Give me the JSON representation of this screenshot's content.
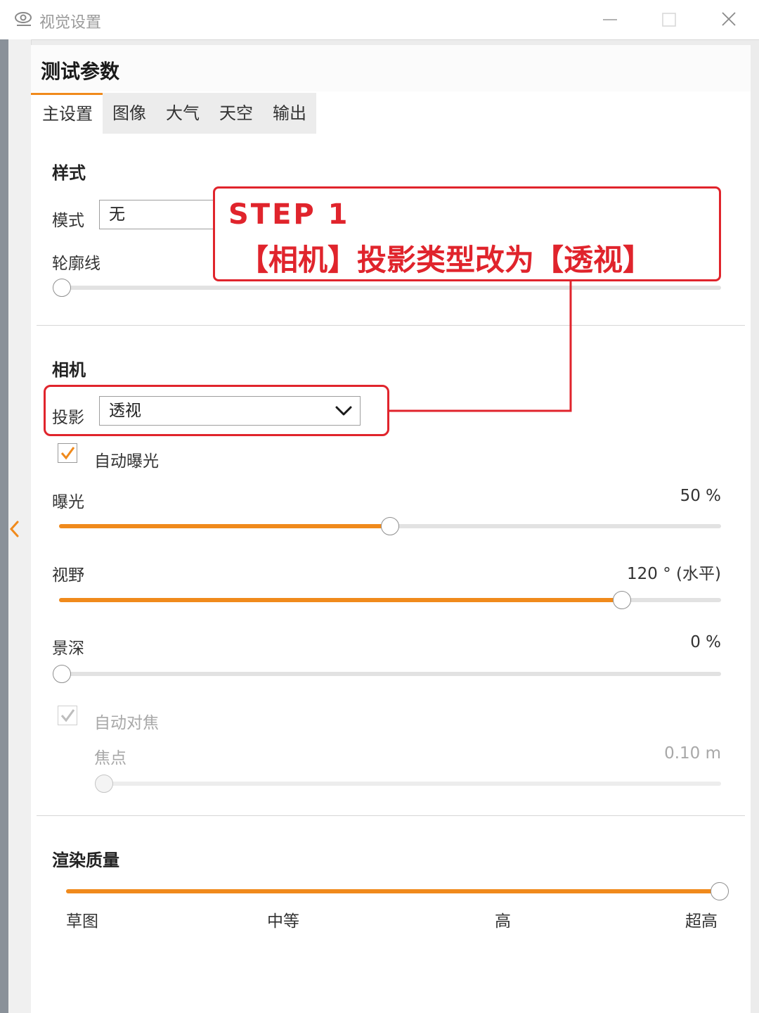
{
  "window": {
    "title": "视觉设置",
    "eye_icon": "eye-icon",
    "controls": [
      "minimize-icon",
      "maximize-icon",
      "close-icon"
    ]
  },
  "panel": {
    "title": "测试参数",
    "tabs": [
      {
        "label": "主设置",
        "active": true
      },
      {
        "label": "图像",
        "active": false
      },
      {
        "label": "大气",
        "active": false
      },
      {
        "label": "天空",
        "active": false
      },
      {
        "label": "输出",
        "active": false
      }
    ]
  },
  "style_section": {
    "title": "样式",
    "mode_label": "模式",
    "mode_value": "无",
    "outline_label": "轮廓线",
    "outline_value": "0 %",
    "outline_fraction": 0
  },
  "camera_section": {
    "title": "相机",
    "projection_label": "投影",
    "projection_value": "透视",
    "auto_exposure_label": "自动曝光",
    "auto_exposure_checked": true,
    "exposure_label": "曝光",
    "exposure_value": "50 %",
    "exposure_fraction": 0.5,
    "fov_label": "视野",
    "fov_value": "120 ° (水平)",
    "fov_fraction": 0.85,
    "dof_label": "景深",
    "dof_value": "0 %",
    "dof_fraction": 0,
    "autofocus_label": "自动对焦",
    "autofocus_checked": true,
    "focus_label": "焦点",
    "focus_value": "0.10 m",
    "focus_fraction": 0
  },
  "render_section": {
    "title": "渲染质量",
    "levels": [
      "草图",
      "中等",
      "高",
      "超高"
    ],
    "selected_level": "超高"
  },
  "annotation": {
    "step": "STEP 1",
    "text": "【相机】投影类型改为【透视】",
    "color": "#e0242c"
  },
  "accent_color": "#f08a1c"
}
